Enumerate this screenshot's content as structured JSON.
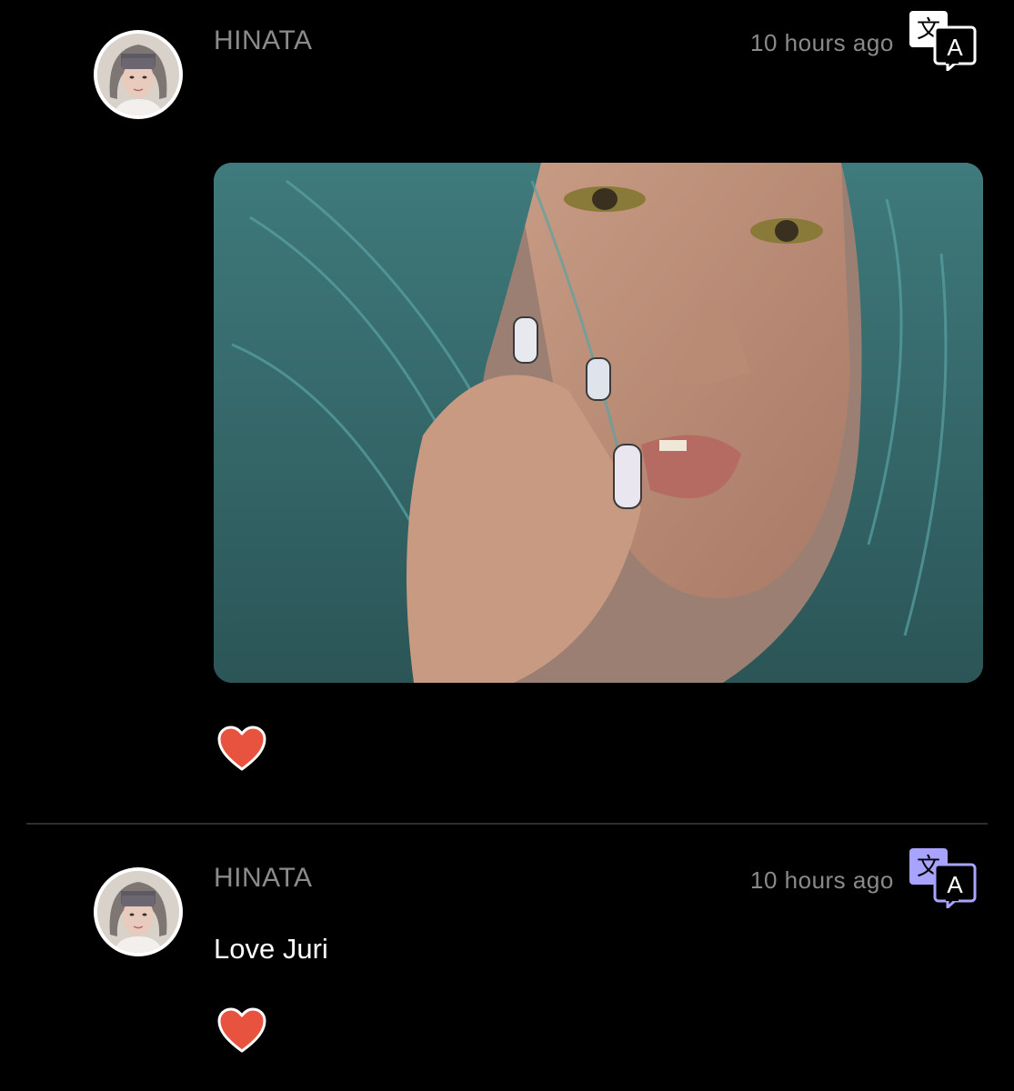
{
  "colors": {
    "background": "#000000",
    "username": "#8b8b8b",
    "timestamp": "#8a8a8a",
    "like_heart": "#e8533f",
    "translate_active": "#a7a3ff",
    "divider": "#2e2e2e"
  },
  "posts": [
    {
      "username": "HINATA",
      "timestamp": "10 hours ago",
      "avatar_icon": "avatar",
      "translate_icon": "translate-icon",
      "media": "photo",
      "like_icon": "heart-icon"
    },
    {
      "username": "HINATA",
      "timestamp": "10 hours ago",
      "text": "Love Juri",
      "avatar_icon": "avatar",
      "translate_icon": "translate-icon",
      "like_icon": "heart-icon"
    }
  ]
}
